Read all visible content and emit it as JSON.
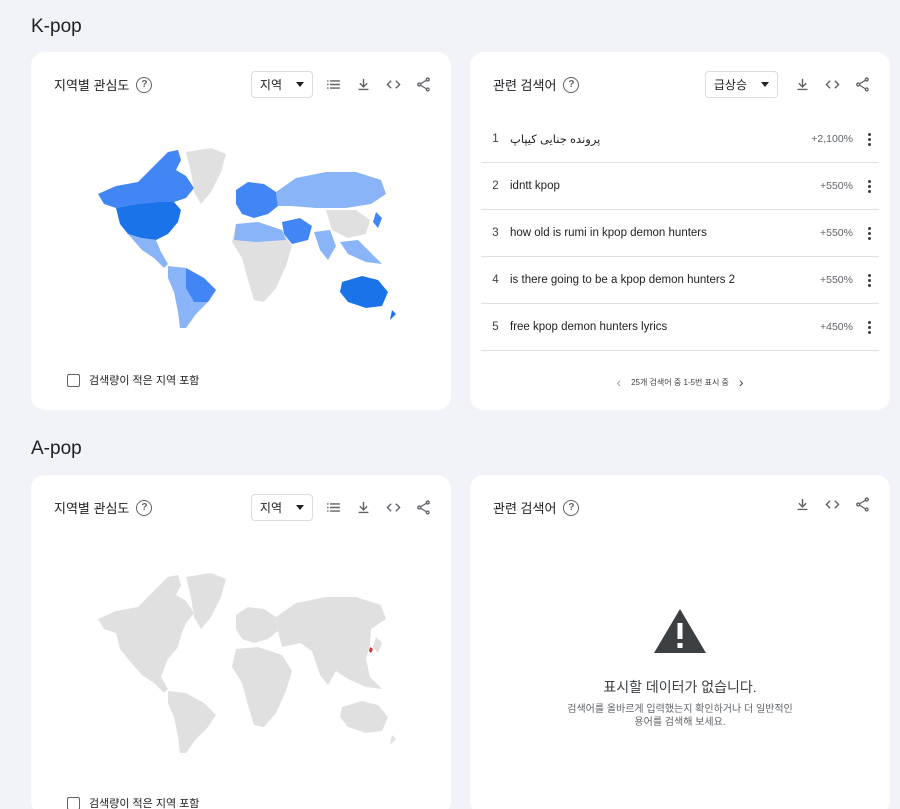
{
  "sections": [
    {
      "title": "K-pop",
      "region_card": {
        "title": "지역별 관심도",
        "dropdown": "지역",
        "checkbox_label": "검색량이 적은 지역 포함"
      },
      "related_card": {
        "title": "관련 검색어",
        "dropdown": "급상승",
        "rows": [
          {
            "rank": "1",
            "query": "پرونده جنایی کیپاپ",
            "value": "+2,100%"
          },
          {
            "rank": "2",
            "query": "idntt kpop",
            "value": "+550%"
          },
          {
            "rank": "3",
            "query": "how old is rumi in kpop demon hunters",
            "value": "+550%"
          },
          {
            "rank": "4",
            "query": "is there going to be a kpop demon hunters 2",
            "value": "+550%"
          },
          {
            "rank": "5",
            "query": "free kpop demon hunters lyrics",
            "value": "+450%"
          }
        ],
        "pager": "25개 검색어 중 1-5번 표시 중"
      }
    },
    {
      "title": "A-pop",
      "region_card": {
        "title": "지역별 관심도",
        "dropdown": "지역",
        "checkbox_label": "검색량이 적은 지역 포함"
      },
      "related_card": {
        "title": "관련 검색어",
        "no_data_title": "표시할 데이터가 없습니다.",
        "no_data_line1": "검색어를 올바르게 입력했는지 확인하거나 더 일반적인",
        "no_data_line2": "용어를 검색해 보세요."
      }
    }
  ],
  "icons": {
    "help": "help-circle-icon",
    "list": "list-icon",
    "download": "download-icon",
    "embed": "code-icon",
    "share": "share-icon",
    "more": "more-vert-icon",
    "warning": "warning-icon"
  },
  "colors": {
    "map_dark": "#1a73e8",
    "map_medium": "#4285f4",
    "map_light": "#8ab4f8",
    "map_none": "#e0e0e0",
    "map_highlight": "#d93025"
  }
}
